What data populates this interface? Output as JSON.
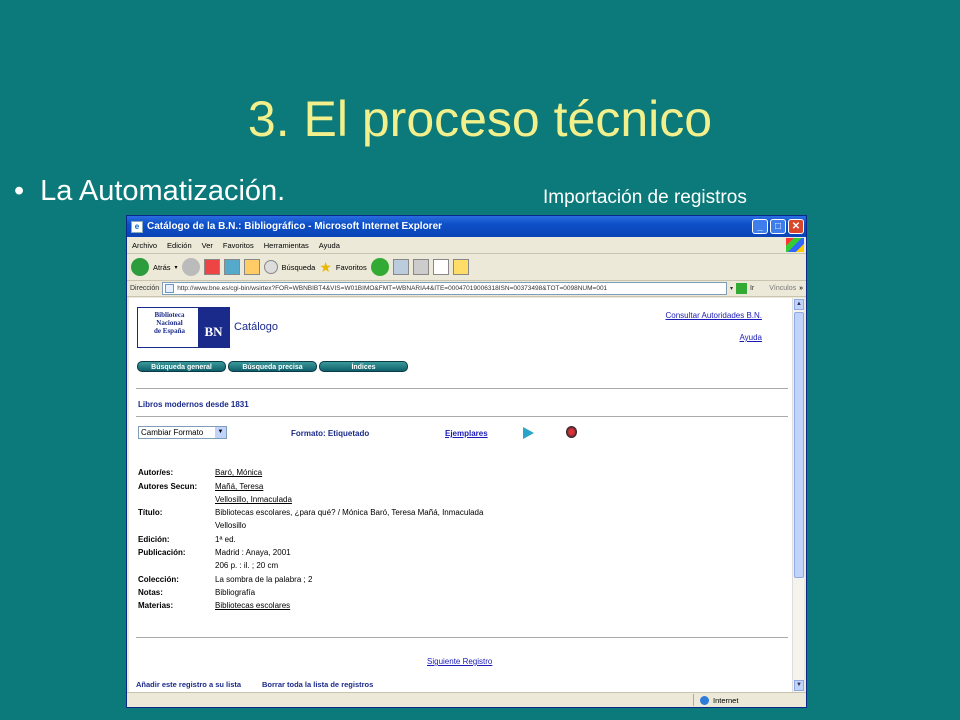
{
  "slide": {
    "title": "3. El proceso técnico",
    "bullet_char": "•",
    "bullet": "La Automatización.",
    "caption": "Importación de registros"
  },
  "window": {
    "title": "Catálogo de la B.N.: Bibliográfico - Microsoft Internet Explorer",
    "min": "_",
    "max": "□",
    "close": "✕"
  },
  "menu": [
    "Archivo",
    "Edición",
    "Ver",
    "Favoritos",
    "Herramientas",
    "Ayuda"
  ],
  "toolbar": {
    "back": "Atrás",
    "search": "Búsqueda",
    "favorites": "Favoritos"
  },
  "address": {
    "label": "Dirección",
    "url": "http://www.bne.es/cgi-bin/wsirtex?FOR=WBNBIBT4&VIS=W01BIMO&FMT=WBNARIA4&ITE=00047019006318ISN=00373498&TOT=0098NUM=001",
    "go": "Ir",
    "links": "Vínculos"
  },
  "page": {
    "logo_lines": [
      "Biblioteca",
      "Nacional",
      "de España"
    ],
    "logo_mark": "BN",
    "catalog_title": "Catálogo",
    "auth_link": "Consultar Autoridades B.N.",
    "help_link": "Ayuda",
    "tabs": [
      "Búsqueda general",
      "Búsqueda precisa",
      "Índices"
    ],
    "section_title": "Libros modernos desde 1831",
    "format_select": "Cambiar Formato",
    "format_label": "Formato: Etiquetado",
    "ejemplares": "Ejemplares",
    "record": [
      {
        "label": "Autor/es:",
        "value": "Baró, Mónica",
        "link": true
      },
      {
        "label": "Autores Secun:",
        "value": "Mañá, Teresa",
        "link": true
      },
      {
        "label": "",
        "value": "Vellosillo, Inmaculada",
        "link": true
      },
      {
        "label": "Título:",
        "value": "Bibliotecas escolares, ¿para qué? / Mónica Baró, Teresa Mañá, Inmaculada",
        "link": false
      },
      {
        "label": "",
        "value": "Vellosillo",
        "link": false
      },
      {
        "label": "Edición:",
        "value": "1ª ed.",
        "link": false
      },
      {
        "label": "Publicación:",
        "value": "Madrid : Anaya, 2001",
        "link": false
      },
      {
        "label": "",
        "value": "206 p. : il. ; 20 cm",
        "link": false
      },
      {
        "label": "Colección:",
        "value": "La sombra de la palabra ; 2",
        "link": false
      },
      {
        "label": "Notas:",
        "value": "Bibliografía",
        "link": false
      },
      {
        "label": "Materias:",
        "value": "Bibliotecas escolares",
        "link": true
      }
    ],
    "next_record": "Siguiente Registro",
    "add_to_list": "Añadir este registro a su lista",
    "clear_list": "Borrar toda la lista de registros"
  },
  "status": {
    "zone": "Internet"
  }
}
